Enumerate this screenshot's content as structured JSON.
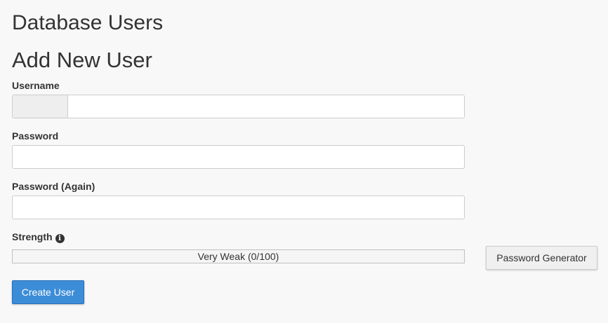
{
  "page": {
    "section_title": "Database Users",
    "form_title": "Add New User"
  },
  "form": {
    "username": {
      "label": "Username",
      "prefix": "",
      "value": "",
      "placeholder": ""
    },
    "password": {
      "label": "Password",
      "value": "",
      "placeholder": ""
    },
    "password_again": {
      "label": "Password (Again)",
      "value": "",
      "placeholder": ""
    },
    "strength": {
      "label": "Strength",
      "info_icon": "info-circle-icon",
      "text": "Very Weak (0/100)",
      "score_fraction": 0
    },
    "generator_button": "Password Generator",
    "submit_button": "Create User"
  },
  "colors": {
    "primary_button": "#3c8dd8",
    "background": "#f8f8f8"
  }
}
